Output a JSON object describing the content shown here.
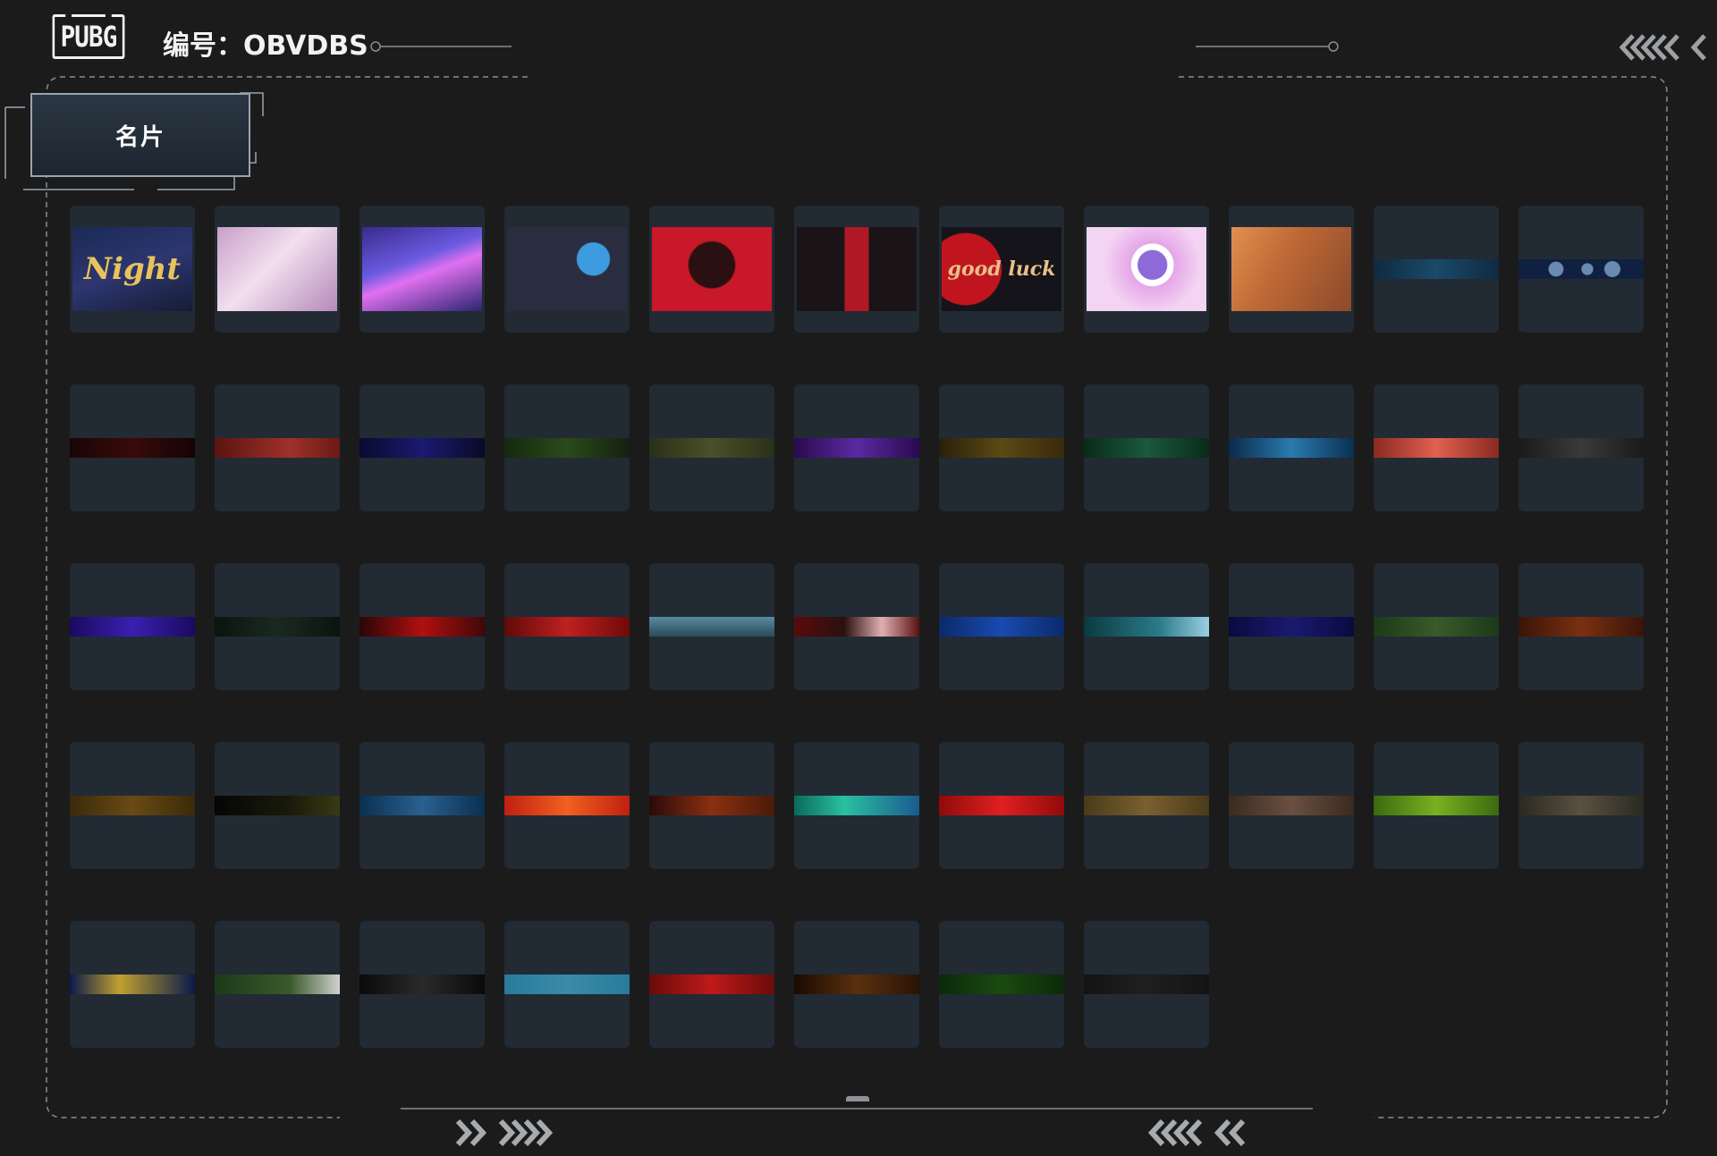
{
  "header": {
    "logo_text": "PUBG",
    "title": "编号：OBVDBS"
  },
  "tab": {
    "label": "名片"
  },
  "colors": {
    "background": "#1b1b1c",
    "card": "#222a33",
    "line": "#8a8d90"
  },
  "cards": [
    {
      "name": "name-card-night",
      "thumb": "linear-gradient(160deg,#1a2a55 0%,#2d3670 50%,#161c35 100%)",
      "text": "Night",
      "text_color": "#e8c35a"
    },
    {
      "name": "name-card-bunnies",
      "thumb": "linear-gradient(135deg,#c89fc8 0%,#f2dff0 45%,#b48ab8 100%)"
    },
    {
      "name": "name-card-neon-jet",
      "thumb": "linear-gradient(160deg,#3a2a8a 0%,#6a5ae0 40%,#e070f0 55%,#2a2570 100%)"
    },
    {
      "name": "name-card-astronaut",
      "thumb": "radial-gradient(circle at 72% 38%,#3d9be0 0 16%,#2a2d40 17%),linear-gradient(#2a2d40,#2a2d40)"
    },
    {
      "name": "name-card-chained-wolf",
      "thumb": "radial-gradient(circle at 50% 45%,#2a1010 0 30%,#c9182a 32%)"
    },
    {
      "name": "name-card-black-wolves",
      "thumb": "linear-gradient(90deg,#1a1416 0%,#1a1416 40%,#b01826 40%,#b01826 60%,#1a1416 60%)"
    },
    {
      "name": "name-card-good-luck",
      "thumb": "radial-gradient(circle at 20% 50%,#c0151f 0 34%,#14141a 35%)",
      "text": "good luck",
      "text_color": "#e8c08a"
    },
    {
      "name": "name-card-flower",
      "thumb": "radial-gradient(circle at 55% 45%,#8e6ad8 0 18%,#ffffff 19% 26%,#e6a5e8 27%,#f3d4f3 60%)"
    },
    {
      "name": "name-card-goggles-girl",
      "thumb": "linear-gradient(120deg,#e09050 0%,#c06a36 40%,#8a4a2a 100%)"
    },
    {
      "name": "name-card-blue-strip",
      "strip": "linear-gradient(90deg,#0f2a40,#1a4a6a 50%,#0f2a40)"
    },
    {
      "name": "name-card-moon-phases",
      "strip": "radial-gradient(circle at 30% 50%,#6a8ab0 0 8%,transparent 9%),radial-gradient(circle at 55% 50%,#6a8ab0 0 8%,transparent 9%),radial-gradient(circle at 75% 50%,#6a8ab0 0 8%,transparent 9%),linear-gradient(#102040,#102040)"
    },
    {
      "name": "name-card-strip-12",
      "strip": "linear-gradient(90deg,#1a0606,#3a0a0a 50%,#140404)"
    },
    {
      "name": "name-card-strip-13",
      "strip": "linear-gradient(90deg,#5a1410,#a0302a 60%,#6a1a14)"
    },
    {
      "name": "name-card-strip-14",
      "strip": "linear-gradient(90deg,#0a0a30,#1a1a70 50%,#0a0a28)"
    },
    {
      "name": "name-card-strip-15",
      "strip": "linear-gradient(90deg,#142a10,#2a4a1a 50%,#142010)"
    },
    {
      "name": "name-card-strip-16",
      "strip": "linear-gradient(90deg,#2a3018,#4a5028 50%,#2a3018)"
    },
    {
      "name": "name-card-strip-17",
      "strip": "linear-gradient(90deg,#2a0a50,#5a2aa0 50%,#2a0a50)"
    },
    {
      "name": "name-card-strip-18",
      "strip": "linear-gradient(90deg,#2a200a,#5a4a14 50%,#3a2a0a)"
    },
    {
      "name": "name-card-strip-19",
      "strip": "linear-gradient(90deg,#0a2a1a,#1a5a3a 50%,#0a2a1a)"
    },
    {
      "name": "name-card-strip-20",
      "strip": "linear-gradient(90deg,#0a2a4a,#2a7ab0 50%,#0a3050)"
    },
    {
      "name": "name-card-strip-21",
      "strip": "linear-gradient(90deg,#8a2a20,#e06050 50%,#8a2a20)"
    },
    {
      "name": "name-card-strip-22",
      "strip": "linear-gradient(90deg,#1a1a1a,#3a3a3a 50%,#1a1a1a)"
    },
    {
      "name": "name-card-strip-23",
      "strip": "linear-gradient(90deg,#1a0a60,#3a20b0 50%,#1a0a60)"
    },
    {
      "name": "name-card-strip-24",
      "strip": "linear-gradient(90deg,#0a1410,#1a2a20 50%,#0a1410)"
    },
    {
      "name": "name-card-strip-25",
      "strip": "linear-gradient(90deg,#2a0606,#b01010 50%,#400808)"
    },
    {
      "name": "name-card-strip-26",
      "strip": "linear-gradient(90deg,#600a0a,#c02020 50%,#700a0a)"
    },
    {
      "name": "name-card-strip-27",
      "strip": "linear-gradient(180deg,#5a8aa0,#2a4a5a)"
    },
    {
      "name": "name-card-strip-28",
      "strip": "linear-gradient(90deg,#5a0a0a,#2a1010 40%,#e0b0b0 70%,#5a1010)"
    },
    {
      "name": "name-card-strip-29",
      "strip": "linear-gradient(90deg,#0a2a6a,#1a4ab0 50%,#0a2a6a)"
    },
    {
      "name": "name-card-strip-30",
      "strip": "linear-gradient(90deg,#0a3a40,#2a7a8a 60%,#9ad0e0)"
    },
    {
      "name": "name-card-strip-31",
      "strip": "linear-gradient(90deg,#0a0a40,#1a1a70 50%,#0a0a40)"
    },
    {
      "name": "name-card-strip-32",
      "strip": "linear-gradient(90deg,#1a3a1a,#3a5a2a 50%,#1a3a1a)"
    },
    {
      "name": "name-card-strip-33",
      "strip": "linear-gradient(90deg,#3a140a,#7a3010 50%,#3a140a)"
    },
    {
      "name": "name-card-strip-34",
      "strip": "linear-gradient(90deg,#3a2a0a,#6a4a14 50%,#3a2a0a)"
    },
    {
      "name": "name-card-strip-35",
      "strip": "linear-gradient(90deg,#050505,#1a1a0a 60%,#3a3a14)"
    },
    {
      "name": "name-card-strip-36",
      "strip": "linear-gradient(90deg,#0a3050,#2a6090 50%,#0a3050)"
    },
    {
      "name": "name-card-strip-37",
      "strip": "linear-gradient(90deg,#c02010,#f06020 50%,#c02010)"
    },
    {
      "name": "name-card-strip-38",
      "strip": "linear-gradient(90deg,#2a0a0a,#8a3010 50%,#4a1a0a)"
    },
    {
      "name": "name-card-strip-39",
      "strip": "linear-gradient(90deg,#0a6a5a,#2ac0a0 40%,#1a5a90)"
    },
    {
      "name": "name-card-strip-40",
      "strip": "linear-gradient(90deg,#900a0a,#e02020 50%,#900a0a)"
    },
    {
      "name": "name-card-strip-41",
      "strip": "linear-gradient(90deg,#4a3a1a,#7a6030 50%,#4a3a1a)"
    },
    {
      "name": "name-card-strip-42",
      "strip": "linear-gradient(90deg,#3a2a20,#6a5040 50%,#3a2a20)"
    },
    {
      "name": "name-card-strip-43",
      "strip": "linear-gradient(90deg,#3a6a10,#7ab020 50%,#3a6a10)"
    },
    {
      "name": "name-card-strip-44",
      "strip": "linear-gradient(90deg,#2a2a20,#5a5040 50%,#2a2a20)"
    },
    {
      "name": "name-card-strip-45",
      "strip": "linear-gradient(90deg,#0a1a4a,#c0a030 40%,#0a1a4a)"
    },
    {
      "name": "name-card-strip-46",
      "strip": "linear-gradient(90deg,#1a3a1a,#3a5a2a 60%,#d0d0d0)"
    },
    {
      "name": "name-card-strip-47",
      "strip": "linear-gradient(90deg,#0a0a0a,#2a2a2a 50%,#0a0a0a)"
    },
    {
      "name": "name-card-strip-48",
      "strip": "linear-gradient(90deg,#2a7a9a,#3a8aa8 50%,#2a7a9a)"
    },
    {
      "name": "name-card-strip-49",
      "strip": "linear-gradient(90deg,#6a0a0a,#c01a1a 50%,#6a0a0a)"
    },
    {
      "name": "name-card-strip-50",
      "strip": "linear-gradient(90deg,#1a0a00,#5a3010 50%,#2a1404)"
    },
    {
      "name": "name-card-strip-51",
      "strip": "linear-gradient(90deg,#0a2a0a,#1a4a10 50%,#0a2a0a)"
    },
    {
      "name": "name-card-strip-52",
      "strip": "linear-gradient(90deg,#141414,#1f1f1f 50%,#141414)"
    }
  ]
}
